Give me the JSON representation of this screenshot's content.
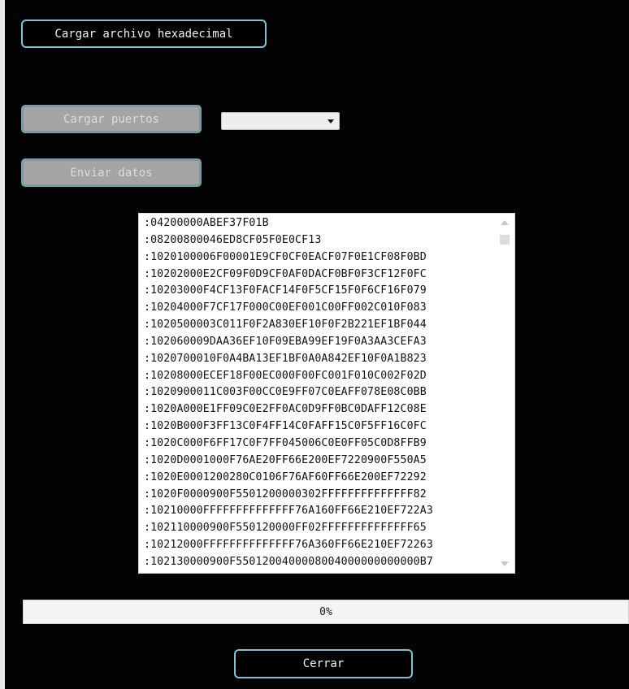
{
  "buttons": {
    "load_hex": "Cargar archivo hexadecimal",
    "load_ports": "Cargar puertos",
    "send_data": "Enviar datos",
    "close": "Cerrar"
  },
  "ports_select": {
    "selected": ""
  },
  "hex_lines": [
    ":04200000ABEF37F01B",
    ":08200800046ED8CF05F0E0CF13",
    ":1020100006F00001E9CF0CF0EACF07F0E1CF08F0BD",
    ":10202000E2CF09F0D9CF0AF0DACF0BF0F3CF12F0FC",
    ":10203000F4CF13F0FACF14F0F5CF15F0F6CF16F079",
    ":10204000F7CF17F000C00EF001C00FF002C010F083",
    ":1020500003C011F0F2A830EF10F0F2B221EF1BF044",
    ":102060009DAA36EF10F09EBA99EF19F0A3AA3CEFA3",
    ":1020700010F0A4BA13EF1BF0A0A842EF10F0A1B823",
    ":10208000ECEF18F00EC000F00FC001F010C002F02D",
    ":1020900011C003F00CC0E9FF07C0EAFF078E08C0BB",
    ":1020A000E1FF09C0E2FF0AC0D9FF0BC0DAFF12C08E",
    ":1020B000F3FF13C0F4FF14C0FAFF15C0F5FF16C0FC",
    ":1020C000F6FF17C0F7FF045006C0E0FF05C0D8FFB9",
    ":1020D0001000F76AE20FF66E200EF7220900F550A5",
    ":1020E0001200280C0106F76AF60FF66E200EF72292",
    ":1020F0000900F5501200000302FFFFFFFFFFFFFF82",
    ":10210000FFFFFFFFFFFFFF76A160FF66E210EF722A3",
    ":102110000900F550120000FF02FFFFFFFFFFFFFF65",
    ":10212000FFFFFFFFFFFFFF76A360FF66E210EF72263",
    ":102130000900F5501200400008004000000000000B7"
  ],
  "progress": {
    "value": 0,
    "label": "0%",
    "fill_color": "#3a9a48"
  },
  "colors": {
    "window_bg": "#030303",
    "accent_border": "#7ec3d3",
    "disabled_button": "#a4a4a4"
  }
}
